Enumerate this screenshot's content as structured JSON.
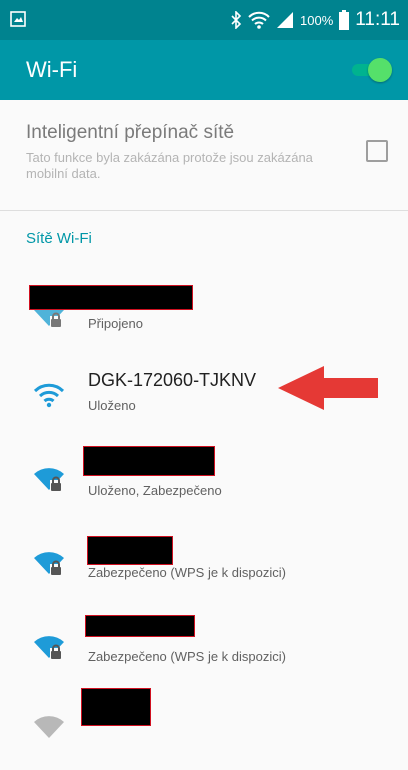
{
  "status_bar": {
    "battery_percent": "100%",
    "time": "11:11",
    "icons": [
      "screenshot-icon",
      "bluetooth-icon",
      "wifi-status-icon",
      "signal-icon",
      "battery-icon"
    ]
  },
  "app_bar": {
    "title": "Wi-Fi",
    "wifi_enabled": true,
    "accent_color": "#0097a7"
  },
  "smart_switch": {
    "title": "Inteligentní přepínač sítě",
    "description": "Tato funkce byla zakázána protože jsou zakázána mobilní data.",
    "checked": false
  },
  "networks_section": {
    "title": "Sítě Wi-Fi",
    "networks": [
      {
        "name": "",
        "status": "Připojeno",
        "redacted": true,
        "secured": true
      },
      {
        "name": "DGK-172060-TJKNV",
        "status": "Uloženo",
        "redacted": false,
        "secured": false
      },
      {
        "name": "",
        "status": "Uloženo, Zabezpečeno",
        "redacted": true,
        "secured": true
      },
      {
        "name": "",
        "status": "Zabezpečeno (WPS je k dispozici)",
        "redacted": true,
        "secured": true
      },
      {
        "name": "",
        "status": "Zabezpečeno (WPS je k dispozici)",
        "redacted": true,
        "secured": true
      },
      {
        "name": "",
        "status": "",
        "redacted": true,
        "secured": false
      }
    ]
  },
  "annotation": {
    "arrow_color": "#e53935"
  }
}
